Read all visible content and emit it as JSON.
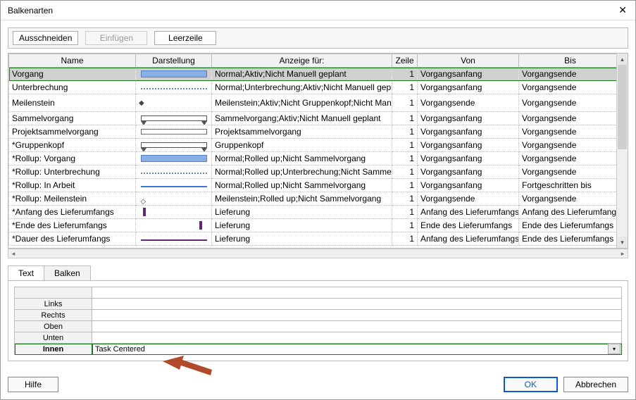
{
  "window": {
    "title": "Balkenarten"
  },
  "toolbar": {
    "cut": "Ausschneiden",
    "paste": "Einfügen",
    "blankrow": "Leerzeile"
  },
  "grid": {
    "headers": {
      "name": "Name",
      "darstellung": "Darstellung",
      "anzeige": "Anzeige für:",
      "zeile": "Zeile",
      "von": "Von",
      "bis": "Bis"
    },
    "rows": [
      {
        "name": "Vorgang",
        "anzeige": "Normal;Aktiv;Nicht Manuell geplant",
        "zeile": "1",
        "von": "Vorgangsanfang",
        "bis": "Vorgangsende",
        "style": "bar-blue",
        "selected": true
      },
      {
        "name": "Unterbrechung",
        "anzeige": "Normal;Unterbrechung;Aktiv;Nicht Manuell geplant",
        "zeile": "1",
        "von": "Vorgangsanfang",
        "bis": "Vorgangsende",
        "style": "bar-dotted-blue"
      },
      {
        "name": "Meilenstein",
        "anzeige": "Meilenstein;Aktiv;Nicht Gruppenkopf;Nicht Manuell geplant",
        "zeile": "1",
        "von": "Vorgangsende",
        "bis": "Vorgangsende",
        "style": "bar-diamond"
      },
      {
        "name": "Sammelvorgang",
        "anzeige": "Sammelvorgang;Aktiv;Nicht Manuell geplant",
        "zeile": "1",
        "von": "Vorgangsanfang",
        "bis": "Vorgangsende",
        "style": "bar-summary"
      },
      {
        "name": "Projektsammelvorgang",
        "anzeige": "Projektsammelvorgang",
        "zeile": "1",
        "von": "Vorgangsanfang",
        "bis": "Vorgangsende",
        "style": "bar-outline"
      },
      {
        "name": "*Gruppenkopf",
        "anzeige": "Gruppenkopf",
        "zeile": "1",
        "von": "Vorgangsanfang",
        "bis": "Vorgangsende",
        "style": "bar-summary"
      },
      {
        "name": "*Rollup: Vorgang",
        "anzeige": "Normal;Rolled up;Nicht Sammelvorgang",
        "zeile": "1",
        "von": "Vorgangsanfang",
        "bis": "Vorgangsende",
        "style": "bar-blue"
      },
      {
        "name": "*Rollup: Unterbrechung",
        "anzeige": "Normal;Rolled up;Unterbrechung;Nicht Sammelvorgang",
        "zeile": "1",
        "von": "Vorgangsanfang",
        "bis": "Vorgangsende",
        "style": "bar-dotted-blue"
      },
      {
        "name": "*Rollup: In Arbeit",
        "anzeige": "Normal;Rolled up;Nicht Sammelvorgang",
        "zeile": "1",
        "von": "Vorgangsanfang",
        "bis": "Fortgeschritten bis",
        "style": "bar-line-blue"
      },
      {
        "name": "*Rollup: Meilenstein",
        "anzeige": "Meilenstein;Rolled up;Nicht Sammelvorgang",
        "zeile": "1",
        "von": "Vorgangsende",
        "bis": "Vorgangsende",
        "style": "bar-diamond-open"
      },
      {
        "name": "*Anfang des Lieferumfangs",
        "anzeige": "Lieferung",
        "zeile": "1",
        "von": "Anfang des Lieferumfangs",
        "bis": "Anfang des Lieferumfangs",
        "style": "bar-tick-purple"
      },
      {
        "name": "*Ende des Lieferumfangs",
        "anzeige": "Lieferung",
        "zeile": "1",
        "von": "Ende des Lieferumfangs",
        "bis": "Ende des Lieferumfangs",
        "style": "bar-tick-purple-r"
      },
      {
        "name": "*Dauer des Lieferumfangs",
        "anzeige": "Lieferung",
        "zeile": "1",
        "von": "Anfang des Lieferumfangs",
        "bis": "Ende des Lieferumfangs",
        "style": "bar-line-purple"
      }
    ]
  },
  "tabs": {
    "text": "Text",
    "balken": "Balken"
  },
  "textgrid": {
    "rows": [
      {
        "label": "",
        "value": ""
      },
      {
        "label": "Links",
        "value": ""
      },
      {
        "label": "Rechts",
        "value": ""
      },
      {
        "label": "Oben",
        "value": ""
      },
      {
        "label": "Unten",
        "value": ""
      },
      {
        "label": "Innen",
        "value": "Task Centered",
        "selected": true
      }
    ]
  },
  "footer": {
    "help": "Hilfe",
    "ok": "OK",
    "cancel": "Abbrechen"
  }
}
